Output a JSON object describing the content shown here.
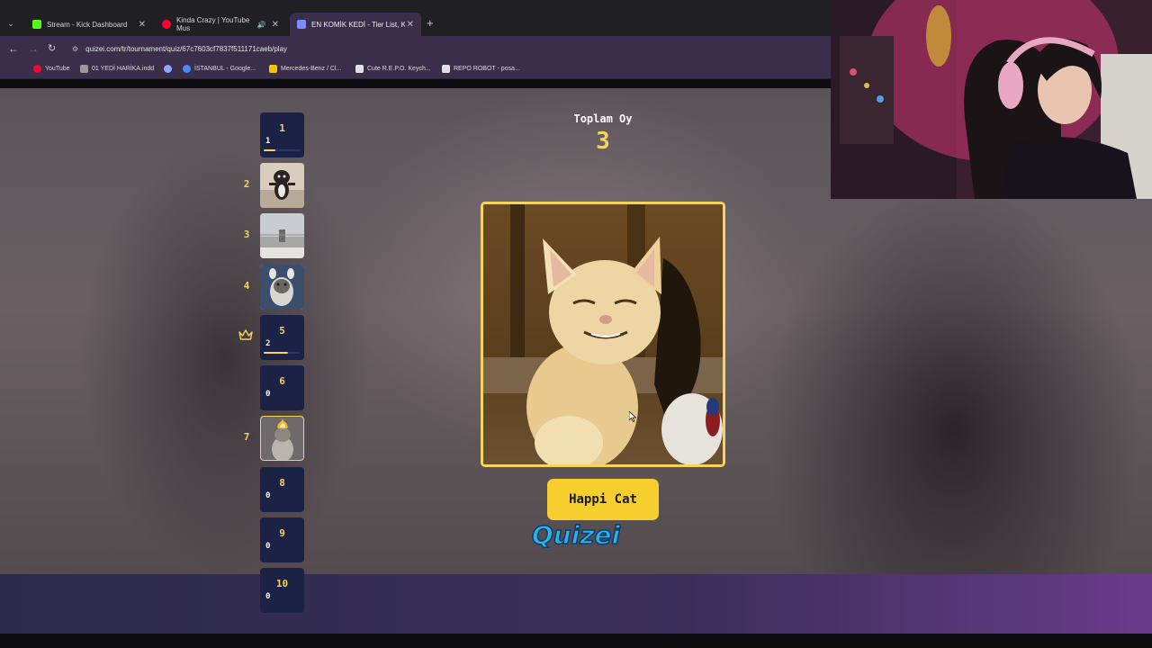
{
  "browser": {
    "tabs": [
      {
        "title": "Stream - Kick Dashboard",
        "favicon_color": "#53fc18"
      },
      {
        "title": "Kinda Crazy | YouTube Mus",
        "favicon_color": "#ff0033"
      },
      {
        "title": "EN KOMİK KEDİ - Tier List, Kor",
        "favicon_color": "#7a8cff"
      }
    ],
    "url": "quizei.com/tr/tournament/quiz/67c7603cf7837f511171caeb/play",
    "bookmarks": [
      {
        "label": "YouTube",
        "color": "#ff0033"
      },
      {
        "label": "01 YEDİ HARİKA.indd",
        "color": "#9a9a9a"
      },
      {
        "label": "",
        "color": "#8fa8ff"
      },
      {
        "label": "İSTANBUL - Google...",
        "color": "#4a8af4"
      },
      {
        "label": "Mercedes-Benz / Cl...",
        "color": "#f4c20d"
      },
      {
        "label": "Cute R.E.P.O. Keych...",
        "color": "#e0e0e0"
      },
      {
        "label": "REPO ROBOT - posa...",
        "color": "#e0e0e0"
      }
    ]
  },
  "quiz": {
    "total_label": "Toplam Oy",
    "total_value": "3",
    "current_name": "Happi Cat",
    "brand": "Quizei",
    "accent": "#f4d35e",
    "slots": [
      {
        "num": "1",
        "count": "1",
        "progress": 0.33
      },
      {
        "num": "2",
        "image": "kitten-standing"
      },
      {
        "num": "3",
        "image": "kitten-blurry"
      },
      {
        "num": "4",
        "image": "kitten-paws"
      },
      {
        "num": "5",
        "count": "2",
        "progress": 0.67,
        "leader": true
      },
      {
        "num": "6",
        "count": "0",
        "progress": 0
      },
      {
        "num": "7",
        "image": "kitten-fire"
      },
      {
        "num": "8",
        "count": "0",
        "progress": 0
      },
      {
        "num": "9",
        "count": "0",
        "progress": 0
      },
      {
        "num": "10",
        "count": "0",
        "progress": 0
      }
    ]
  }
}
